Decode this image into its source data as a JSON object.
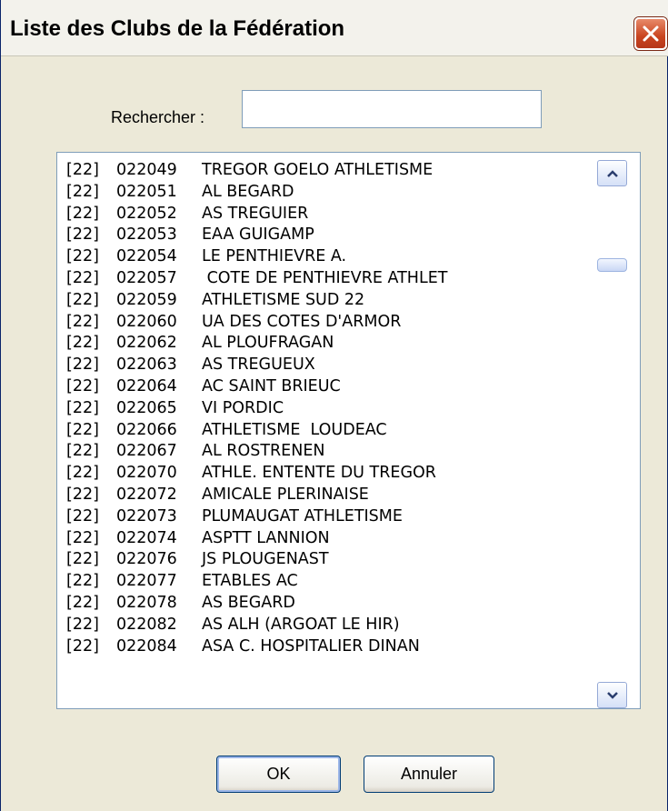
{
  "window": {
    "title": "Liste des Clubs de la Fédération",
    "close_icon": "close-icon"
  },
  "search": {
    "label": "Rechercher :",
    "value": ""
  },
  "clubs": [
    {
      "dept": "[22]",
      "code": "022049",
      "name": "TREGOR GOELO ATHLETISME"
    },
    {
      "dept": "[22]",
      "code": "022051",
      "name": "AL BEGARD"
    },
    {
      "dept": "[22]",
      "code": "022052",
      "name": "AS TREGUIER"
    },
    {
      "dept": "[22]",
      "code": "022053",
      "name": "EAA GUIGAMP"
    },
    {
      "dept": "[22]",
      "code": "022054",
      "name": "LE PENTHIEVRE A."
    },
    {
      "dept": "[22]",
      "code": "022057",
      "name": " COTE DE PENTHIEVRE ATHLET"
    },
    {
      "dept": "[22]",
      "code": "022059",
      "name": "ATHLETISME SUD 22"
    },
    {
      "dept": "[22]",
      "code": "022060",
      "name": "UA DES COTES D'ARMOR"
    },
    {
      "dept": "[22]",
      "code": "022062",
      "name": "AL PLOUFRAGAN"
    },
    {
      "dept": "[22]",
      "code": "022063",
      "name": "AS TREGUEUX"
    },
    {
      "dept": "[22]",
      "code": "022064",
      "name": "AC SAINT BRIEUC"
    },
    {
      "dept": "[22]",
      "code": "022065",
      "name": "VI PORDIC"
    },
    {
      "dept": "[22]",
      "code": "022066",
      "name": "ATHLETISME  LOUDEAC"
    },
    {
      "dept": "[22]",
      "code": "022067",
      "name": "AL ROSTRENEN"
    },
    {
      "dept": "[22]",
      "code": "022070",
      "name": "ATHLE. ENTENTE DU TREGOR"
    },
    {
      "dept": "[22]",
      "code": "022072",
      "name": "AMICALE PLERINAISE"
    },
    {
      "dept": "[22]",
      "code": "022073",
      "name": "PLUMAUGAT ATHLETISME"
    },
    {
      "dept": "[22]",
      "code": "022074",
      "name": "ASPTT LANNION"
    },
    {
      "dept": "[22]",
      "code": "022076",
      "name": "JS PLOUGENAST"
    },
    {
      "dept": "[22]",
      "code": "022077",
      "name": "ETABLES AC"
    },
    {
      "dept": "[22]",
      "code": "022078",
      "name": "AS BEGARD"
    },
    {
      "dept": "[22]",
      "code": "022082",
      "name": "AS ALH (ARGOAT LE HIR)"
    },
    {
      "dept": "[22]",
      "code": "022084",
      "name": "ASA C. HOSPITALIER DINAN"
    }
  ],
  "buttons": {
    "ok_label": "OK",
    "cancel_label": "Annuler"
  },
  "colors": {
    "dialog_bg": "#ece9d8",
    "close_button": "#c9441f",
    "input_border": "#7f9db9"
  }
}
